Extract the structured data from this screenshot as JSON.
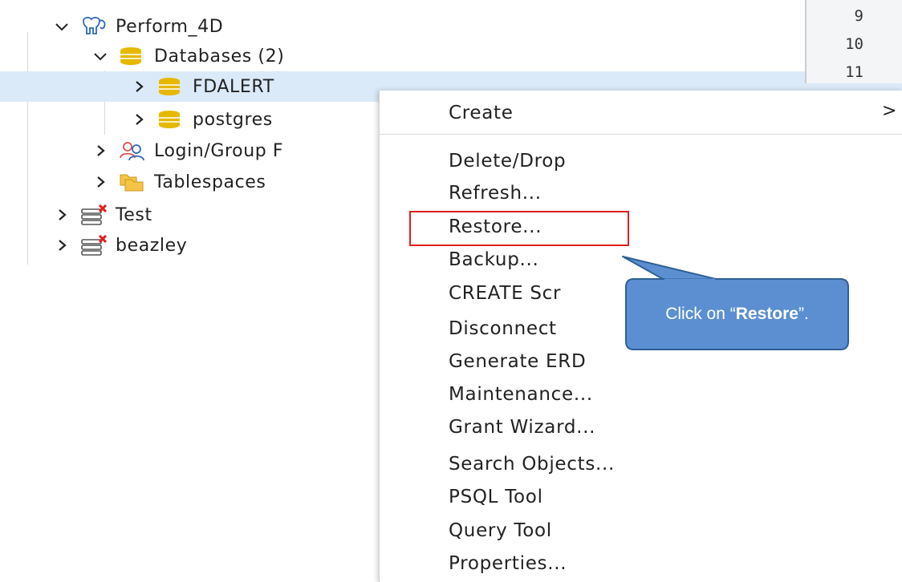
{
  "tree": {
    "server": {
      "label": "Perform_4D"
    },
    "databases": {
      "label": "Databases (2)"
    },
    "db_fdalert": {
      "label": "FDALERT"
    },
    "db_postgres": {
      "label": "postgres"
    },
    "login_roles": {
      "label": "Login/Group F"
    },
    "tablespaces": {
      "label": "Tablespaces"
    },
    "server_test": {
      "label": "Test"
    },
    "server_beazley": {
      "label": "beazley"
    }
  },
  "gutter": {
    "lines": [
      "9",
      "10",
      "11"
    ]
  },
  "context_menu": {
    "items": [
      "Create",
      "Delete/Drop",
      "Refresh...",
      "Restore...",
      "Backup...",
      "CREATE Scr",
      "Disconnect",
      "Generate ERD",
      "Maintenance...",
      "Grant Wizard...",
      "Search Objects...",
      "PSQL Tool",
      "Query Tool",
      "Properties..."
    ],
    "submenu_arrow": ">"
  },
  "callout": {
    "prefix": "Click on “",
    "emphasis": "Restore",
    "suffix": "”."
  },
  "colors": {
    "selection": "#dbeaf8",
    "highlight_box": "#e01e1e",
    "callout_fill": "#5b8fd1",
    "callout_border": "#2f5f95",
    "db_icon": "#e6b800",
    "server_icon": "#2e6ab3",
    "disconnected_x": "#e01e1e"
  }
}
